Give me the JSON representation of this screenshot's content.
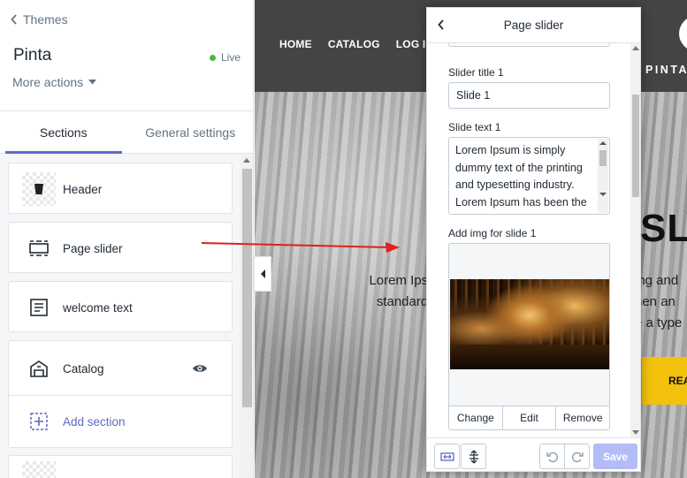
{
  "sidebar": {
    "back_label": "Themes",
    "store_name": "Pinta",
    "status": "Live",
    "more_actions": "More actions",
    "tabs": [
      "Sections",
      "General settings"
    ],
    "sections": [
      {
        "label": "Header",
        "icon": "header-thumbnail"
      },
      {
        "label": "Page slider",
        "icon": "slider-icon"
      },
      {
        "label": "welcome text",
        "icon": "text-icon"
      },
      {
        "label": "Catalog",
        "icon": "catalog-icon"
      },
      {
        "label": "Add section",
        "icon": "add-section-icon"
      }
    ]
  },
  "preview": {
    "nav": [
      "HOME",
      "CATALOG",
      "LOG IN"
    ],
    "brand": "PINTA",
    "hero_left": [
      "Lorem Ipsu",
      "standard"
    ],
    "hero_big": "SLI",
    "hero_right": [
      "ing and",
      "hen an",
      "e a type"
    ],
    "button": "REA"
  },
  "panel": {
    "title": "Page slider",
    "slider_title_label": "Slider title 1",
    "slider_title_value": "Slide 1",
    "slide_text_label": "Slide text 1",
    "slide_text_value": "Lorem Ipsum is simply dummy text of the printing and typesetting industry. Lorem Ipsum has been the",
    "img_label": "Add img for slide 1",
    "img_actions": [
      "Change",
      "Edit",
      "Remove"
    ],
    "save": "Save"
  },
  "colors": {
    "accent": "#5c6ac4",
    "live": "#50b83c",
    "arrow": "#e0201b",
    "save_disabled": "#b3bcf5",
    "hero_button": "#f4c20d"
  }
}
